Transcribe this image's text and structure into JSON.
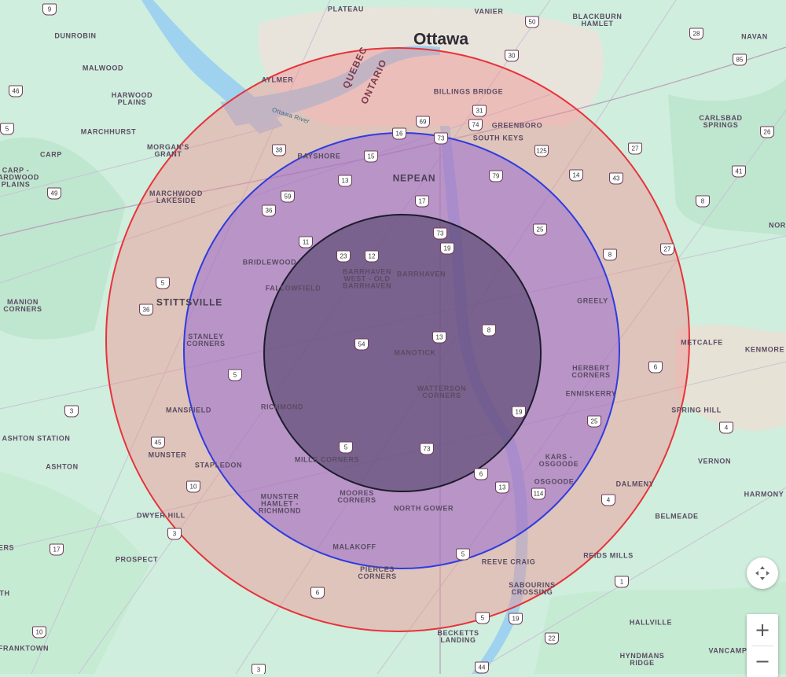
{
  "map": {
    "city_label": "Ottawa",
    "river_label": "Ottawa River",
    "province_labels": [
      "QUEBEC",
      "ONTARIO"
    ],
    "places": [
      "PLATEAU",
      "VANIER",
      "BLACKBURN\nHAMLET",
      "NAVAN",
      "DUNROBIN",
      "MALWOOD",
      "HARWOOD\nPLAINS",
      "MARCHHURST",
      "CARP",
      "CARP -\nHARDWOOD\nPLAINS",
      "AYLMER",
      "BILLINGS BRIDGE",
      "GREENBORO",
      "SOUTH KEYS",
      "CARLSBAD\nSPRINGS",
      "MORGAN'S\nGRANT",
      "BAYSHORE",
      "NEPEAN",
      "MARCHWOOD\nLAKESIDE",
      "BRIDLEWOOD",
      "BARRHAVEN\nWEST - OLD\nBARRHAVEN",
      "BARRHAVEN",
      "FALLOWFIELD",
      "STITTSVILLE",
      "MANION\nCORNERS",
      "GREELY",
      "STANLEY\nCORNERS",
      "MANOTICK",
      "METCALFE",
      "KENMORE",
      "HERBERT\nCORNERS",
      "ENNISKERRY",
      "WATTERSON\nCORNERS",
      "RICHMOND",
      "MANSFIELD",
      "SPRING HILL",
      "ASHTON STATION",
      "MUNSTER",
      "KARS -\nOSGOODE",
      "VERNON",
      "ASHTON",
      "STAPLEDON",
      "MILLE CORNERS",
      "OSGOODE",
      "DALMENY",
      "HARMONY",
      "MUNSTER\nHAMLET -\nRICHMOND",
      "MOORES\nCORNERS",
      "NORTH GOWER",
      "BELMEADE",
      "DWYER HILL",
      "MALAKOFF",
      "PROSPECT",
      "REEVE CRAIG",
      "REIDS MILLS",
      "PIERCES\nCORNERS",
      "SABOURINS\nCROSSING",
      "HALLVILLE",
      "BECKETTS\nLANDING",
      "FRANKTOWN",
      "HYNDMANS\nRIDGE",
      "VANCAMP",
      "ERS",
      "NOR",
      "TH"
    ],
    "road_shields": [
      "9",
      "50",
      "28",
      "85",
      "30",
      "46",
      "26",
      "31",
      "5",
      "69",
      "74",
      "16",
      "73",
      "38",
      "15",
      "125",
      "27",
      "13",
      "79",
      "14",
      "43",
      "41",
      "49",
      "59",
      "17",
      "8",
      "36",
      "25",
      "8",
      "27",
      "73",
      "11",
      "19",
      "23",
      "12",
      "5",
      "36",
      "8",
      "54",
      "13",
      "6",
      "5",
      "3",
      "19",
      "25",
      "45",
      "5",
      "4",
      "73",
      "6",
      "13",
      "114",
      "10",
      "4",
      "3",
      "17",
      "5",
      "1",
      "6",
      "5",
      "19",
      "10",
      "22",
      "44",
      "3"
    ],
    "radius_rings": [
      {
        "name": "outer",
        "stroke": "#e8323a",
        "fill": "#f09090"
      },
      {
        "name": "middle",
        "stroke": "#2f3be0",
        "fill": "#8a5cd8"
      },
      {
        "name": "inner",
        "stroke": "#1d1c2c",
        "fill": "#3b2f55"
      }
    ]
  },
  "controls": {
    "recenter_icon": "recenter-icon",
    "zoom_in_label": "+",
    "zoom_out_label": "−"
  }
}
